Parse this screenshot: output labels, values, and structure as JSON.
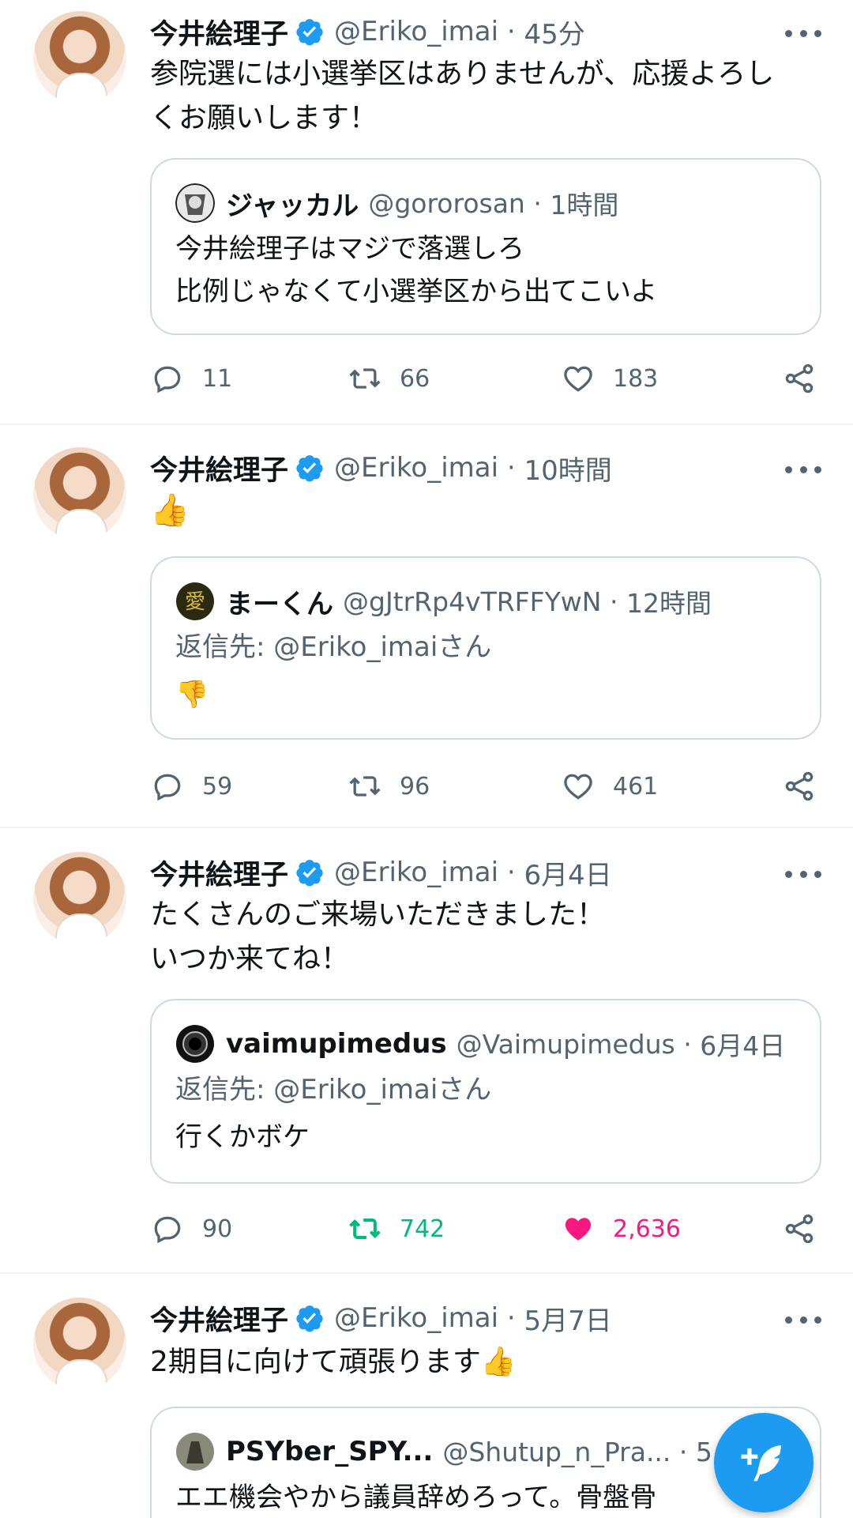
{
  "colors": {
    "accent": "#1d9bf0",
    "retweet_active": "#00ba7c",
    "like_active": "#f91880",
    "secondary_text": "#536471",
    "border": "#cfd9de"
  },
  "tweets": [
    {
      "name": "今井絵理子",
      "handle": "@Eriko_imai",
      "time": "45分",
      "text": "参院選には小選挙区はありませんが、応援よろし\nくお願いします！",
      "quote": {
        "name": "ジャッカル",
        "handle": "@gororosan",
        "time": "1時間",
        "reply_to": "",
        "text": "今井絵理子はマジで落選しろ\n比例じゃなくて小選挙区から出てこいよ"
      },
      "replies": "11",
      "retweets": "66",
      "likes": "183"
    },
    {
      "name": "今井絵理子",
      "handle": "@Eriko_imai",
      "time": "10時間",
      "text": "👍",
      "quote": {
        "name": "まーくん",
        "handle": "@gJtrRp4vTRFFYwN",
        "time": "12時間",
        "reply_to": "返信先: @Eriko_imaiさん",
        "text": "👎"
      },
      "replies": "59",
      "retweets": "96",
      "likes": "461"
    },
    {
      "name": "今井絵理子",
      "handle": "@Eriko_imai",
      "time": "6月4日",
      "text": "たくさんのご来場いただきました！\nいつか来てね！",
      "quote": {
        "name": "vaimupimedus",
        "handle": "@Vaimupimedus",
        "time": "6月4日",
        "reply_to": "返信先: @Eriko_imaiさん",
        "text": "行くかボケ"
      },
      "replies": "90",
      "retweets": "742",
      "likes": "2,636",
      "retweeted": true,
      "liked": true
    },
    {
      "name": "今井絵理子",
      "handle": "@Eriko_imai",
      "time": "5月7日",
      "text": "2期目に向けて頑張ります👍",
      "quote": {
        "name": "PSYber_SPY...",
        "handle": "@Shutup_n_Pra...",
        "time": "5",
        "reply_to": "",
        "text": "エエ機会やから議員辞めろって。骨盤骨"
      }
    }
  ],
  "fab": {
    "icon": "compose-tweet-icon"
  }
}
